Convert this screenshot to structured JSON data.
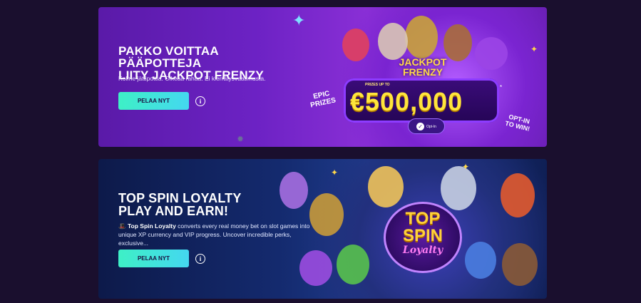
{
  "promos": [
    {
      "title_line1": "PAKKO VOITTAA PÄÄPOTTEJA",
      "title_line2": "LIITY JACKPOT FRENZY",
      "description": "Kolme jättipottia. Oikeaa rahaa. Ei kierrätysvaatimusta.",
      "cta_label": "PELAA NYT",
      "info_label": "i",
      "art": {
        "logo_line1": "JACKPOT",
        "logo_line2": "FRENZY",
        "prizes_label": "PRIZES UP TO",
        "amount": "€500,000",
        "amount_note": "*",
        "epic_line1": "EPIC",
        "epic_line2": "PRIZES",
        "optin_win_line1": "OPT-IN",
        "optin_win_line2": "TO WIN!",
        "optin_button": "Opt-In",
        "optin_check": "✓"
      }
    },
    {
      "title_line1": "TOP SPIN LOYALTY",
      "title_line2": "PLAY AND EARN!",
      "description_emoji": "🎩",
      "description_bold": "Top Spin Loyalty",
      "description_rest": " converts every real money bet on slot games into unique XP currency and VIP progress. Uncover incredible perks, exclusive...",
      "cta_label": "PELAA NYT",
      "info_label": "i",
      "art": {
        "logo_line1": "TOP",
        "logo_line2": "SPIN",
        "logo_line3": "Loyalty"
      }
    }
  ],
  "colors": {
    "page_bg": "#1a0f2e",
    "cta_gradient_start": "#3ef0c6",
    "cta_gradient_end": "#44d7f0",
    "jackpot_yellow": "#ffe53b"
  }
}
